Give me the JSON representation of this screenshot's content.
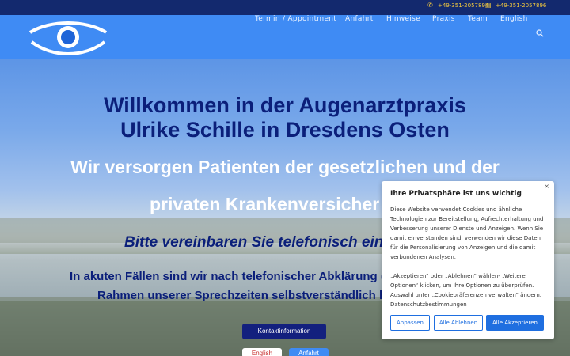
{
  "topbar": {
    "phone": "+49-351-2057894",
    "fax": "+49-351-2057896",
    "phone_icon": "phone-icon",
    "fax_icon": "fax-icon"
  },
  "header": {
    "logo": "eye-logo",
    "nav": [
      {
        "label": "Termin / Appointment"
      },
      {
        "label": "Anfahrt"
      },
      {
        "label": "Hinweise"
      },
      {
        "label": "Praxis"
      },
      {
        "label": "Team"
      },
      {
        "label": "English"
      }
    ],
    "search_icon": "search-icon"
  },
  "hero": {
    "title_line1": "Willkommen in der Augenarztpraxis",
    "title_line2": "Ulrike Schille in Dresdens Osten",
    "subtitle_line1": "Wir versorgen Patienten der gesetzlichen und der",
    "subtitle_line2": "privaten Krankenversicher",
    "phone_cta": "Bitte vereinbaren Sie telefonisch eine",
    "urgent_line1": "In akuten Fällen sind wir nach telefonischer Abklärung (",
    "urgent_line1_tail": "(",
    "urgent_line2": "Rahmen unserer Sprechzeiten selbstverständlich kurz",
    "buttons": {
      "contact": "Kontaktinformation",
      "english": "English",
      "anfahrt": "Anfahrt"
    }
  },
  "cookie": {
    "title": "Ihre Privatsphäre ist uns wichtig",
    "text1": "Diese Website verwendet Cookies und ähnliche Technologien zur Bereitstellung, Aufrechterhaltung und Verbesserung unserer Dienste und Anzeigen. Wenn Sie damit einverstanden sind, verwenden wir diese Daten für die Personalisierung von Anzeigen und die damit verbundenen Analysen.",
    "text2": "„Akzeptieren“ oder „Ablehnen“ wählen- „Weitere Optionen“ klicken, um Ihre Optionen zu überprüfen. Auswahl unter „Cookiepräferenzen verwalten“ ändern.",
    "link": "Datenschutzbestimmungen",
    "btn_adjust": "Anpassen",
    "btn_decline": "Alle Ablehnen",
    "btn_accept": "Alle Akzeptieren",
    "close": "×"
  },
  "colors": {
    "topbar_bg": "#13296e",
    "topbar_text": "#f3c93e",
    "header_bg": "#3f8bf4",
    "title": "#0b1f7a",
    "cookie_accent": "#1f6fe0"
  }
}
